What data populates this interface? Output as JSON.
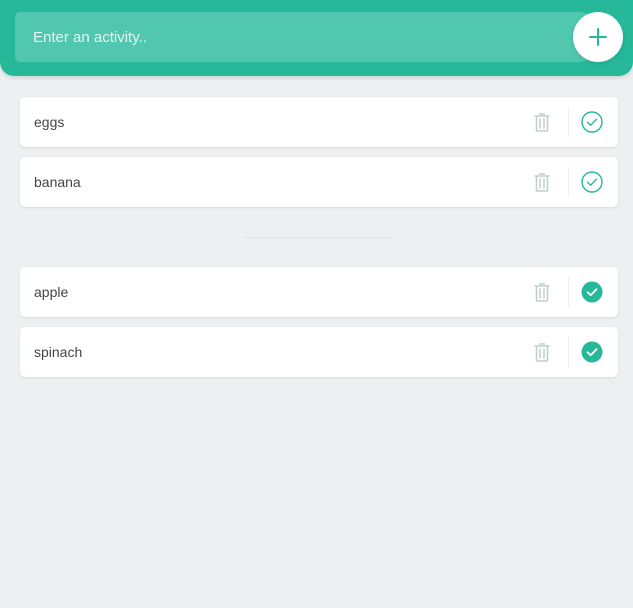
{
  "new_activity": {
    "placeholder": "Enter an activity..",
    "value": "",
    "add_icon": "plus-icon"
  },
  "todo": [
    {
      "label": "eggs",
      "completed": false
    },
    {
      "label": "banana",
      "completed": false
    }
  ],
  "completed": [
    {
      "label": "apple",
      "completed": true
    },
    {
      "label": "spinach",
      "completed": true
    }
  ],
  "icons": {
    "remove": "trash-icon",
    "complete": "check-circle-icon"
  },
  "colors": {
    "accent": "#25b99a",
    "background": "#edf0f1",
    "icon_muted": "#c0cecb",
    "text": "#444444"
  }
}
